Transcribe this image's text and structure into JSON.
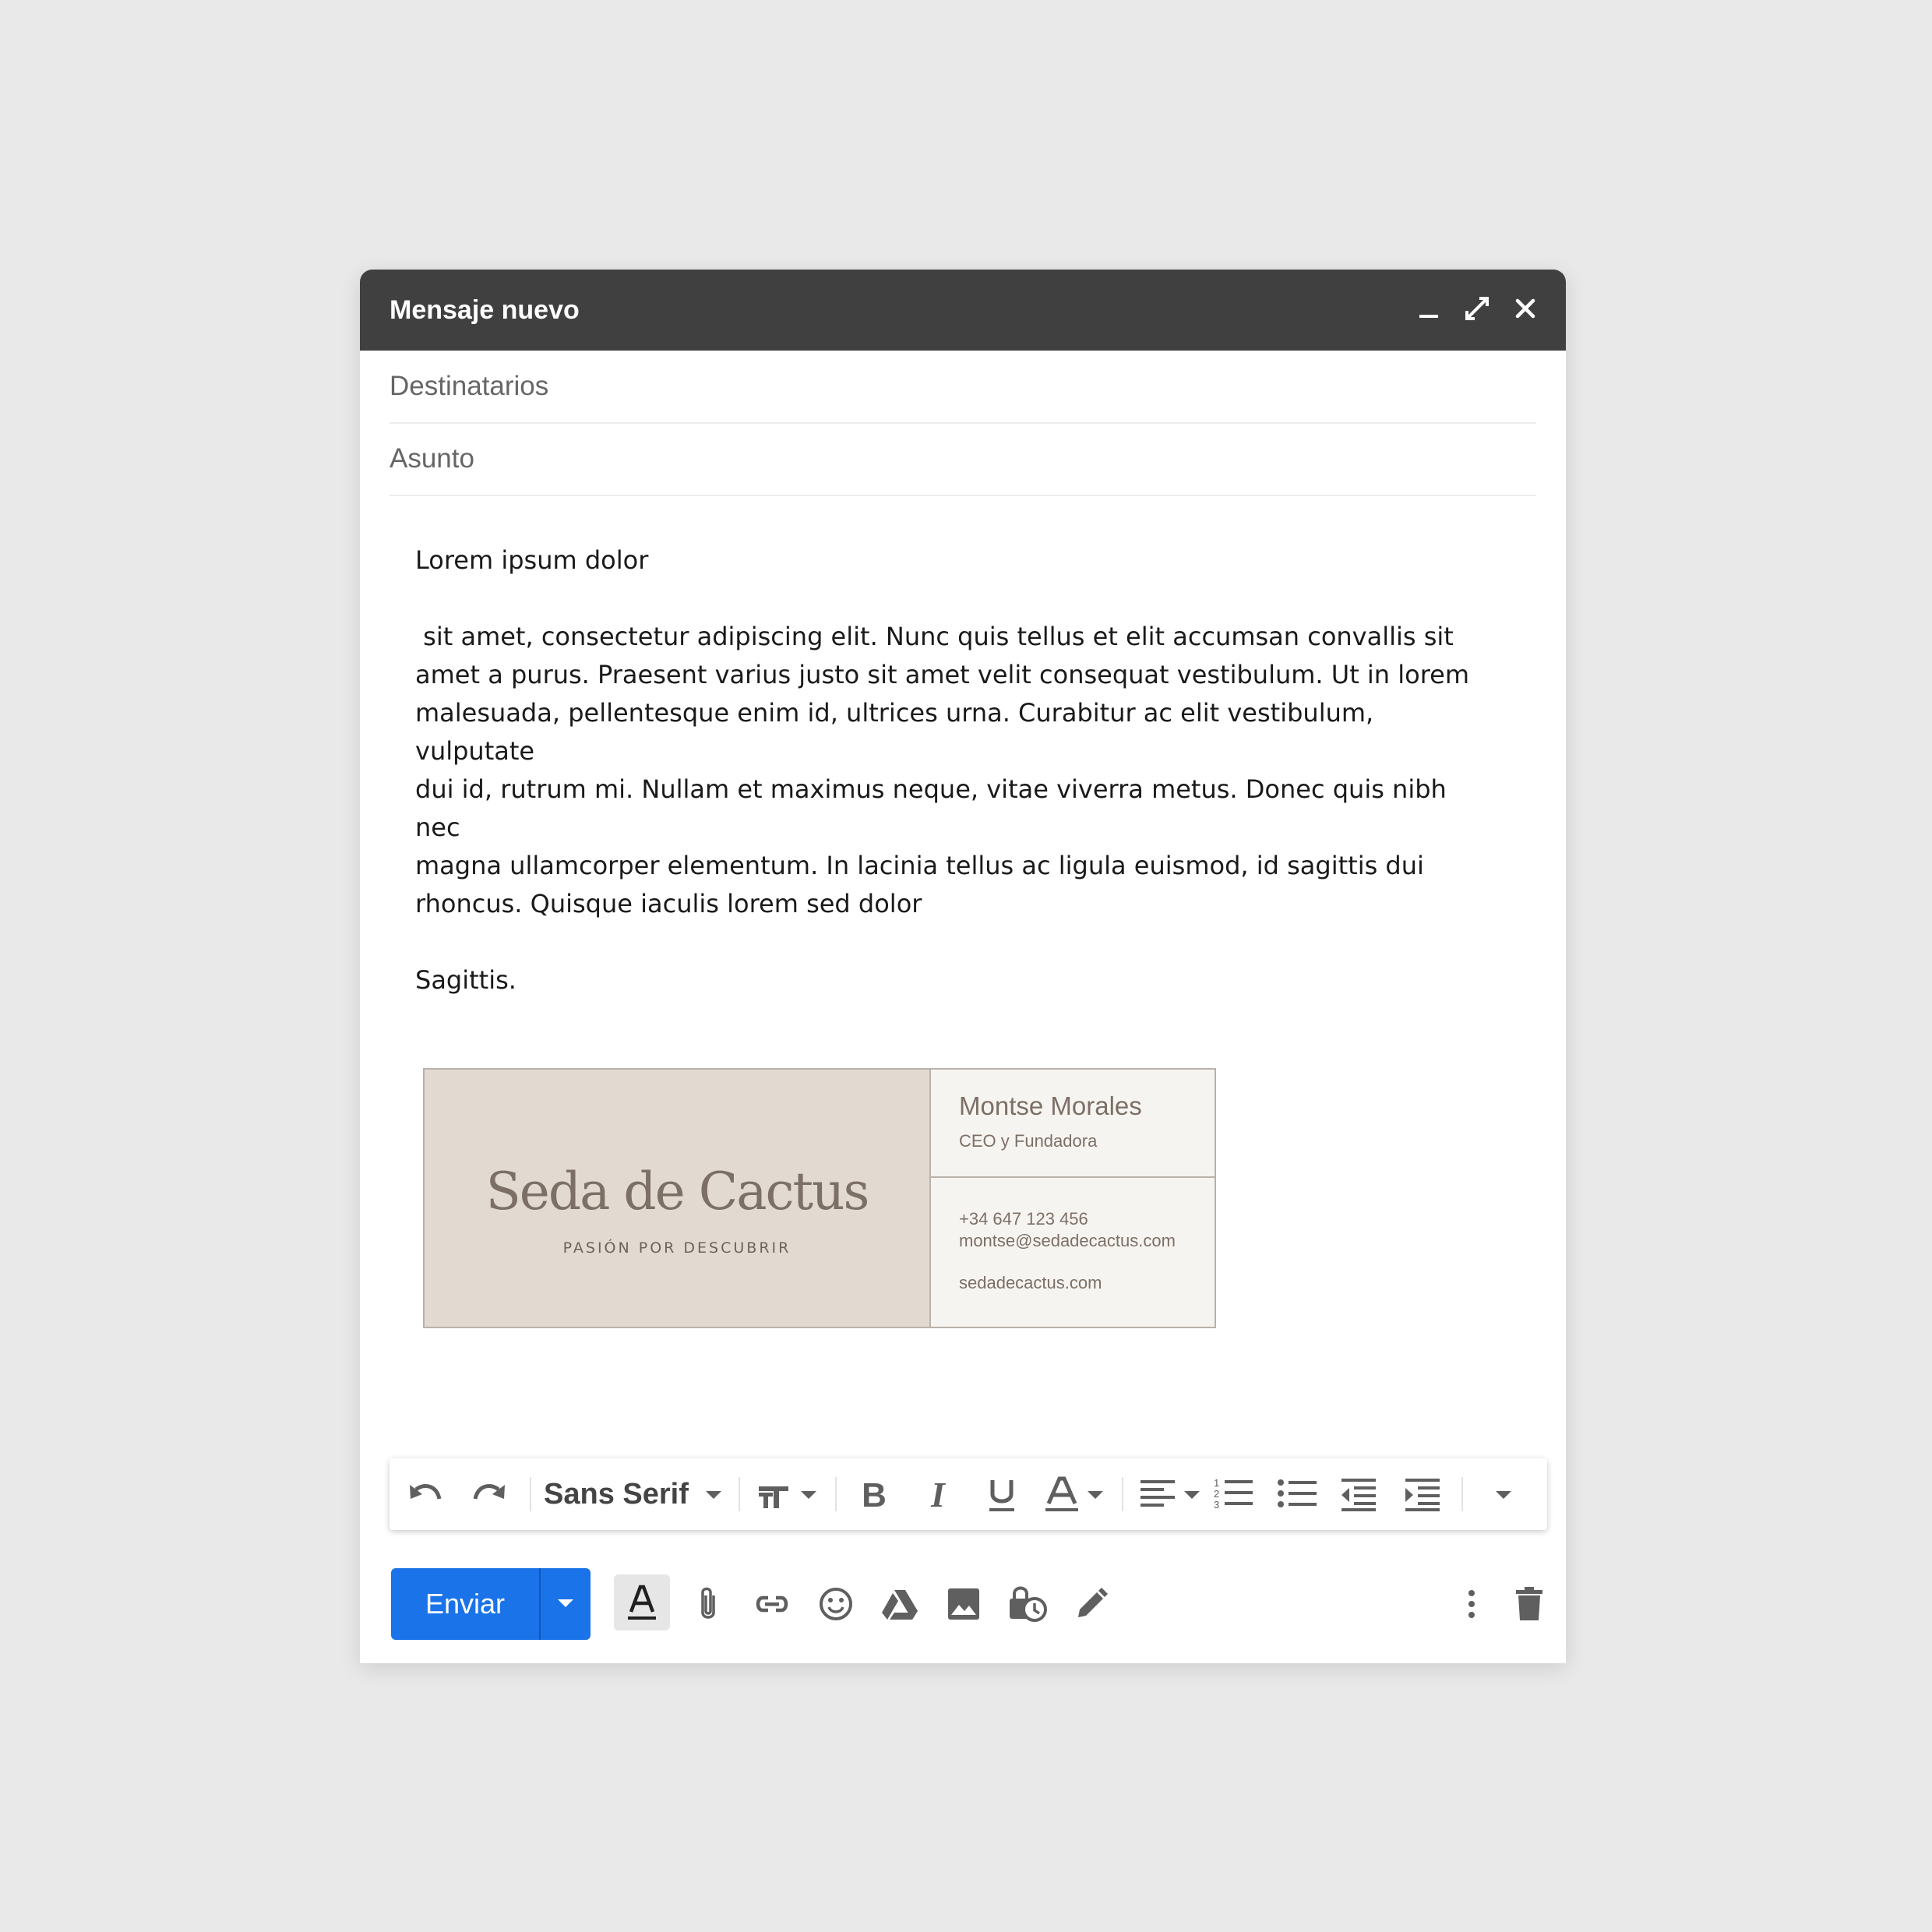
{
  "window": {
    "title": "Mensaje nuevo"
  },
  "fields": {
    "recipients_placeholder": "Destinatarios",
    "subject_placeholder": "Asunto"
  },
  "body": {
    "greeting": "Lorem ipsum dolor",
    "paragraph_lines": [
      " sit amet, consectetur adipiscing elit. Nunc quis tellus et elit accumsan convallis sit",
      "amet a purus. Praesent varius justo sit amet velit consequat vestibulum. Ut in lorem",
      "malesuada, pellentesque enim id, ultrices urna. Curabitur ac elit vestibulum, vulputate",
      "dui id, rutrum mi. Nullam et maximus neque, vitae viverra metus. Donec quis nibh nec",
      "magna ullamcorper elementum. In lacinia tellus ac ligula euismod, id sagittis dui",
      "rhoncus. Quisque iaculis lorem sed dolor"
    ],
    "closing": "Sagittis."
  },
  "signature": {
    "brand": "Seda de Cactus",
    "tagline": "PASIÓN POR DESCUBRIR",
    "name": "Montse Morales",
    "role": "CEO y Fundadora",
    "phone": "+34 647 123 456",
    "email": "montse@sedadecactus.com",
    "website": "sedadecactus.com",
    "colors": {
      "panel": "#e2dad0",
      "text": "#7c6f66",
      "card": "#f6f4f1"
    }
  },
  "format_toolbar": {
    "font": "Sans Serif",
    "icons": [
      "undo-icon",
      "redo-icon",
      "font-family-dropdown",
      "text-size-icon",
      "bold-icon",
      "italic-icon",
      "underline-icon",
      "text-color-icon",
      "align-icon",
      "numbered-list-icon",
      "bulleted-list-icon",
      "indent-less-icon",
      "indent-more-icon",
      "more-formatting-icon"
    ]
  },
  "bottom_toolbar": {
    "send_label": "Enviar",
    "icons": [
      "formatting-options-icon",
      "attach-icon",
      "link-icon",
      "emoji-icon",
      "drive-icon",
      "photo-icon",
      "confidential-mode-icon",
      "signature-icon",
      "more-options-icon",
      "discard-icon"
    ]
  },
  "colors": {
    "titlebar": "#404040",
    "send": "#1a73e8",
    "background": "#e9e9e9",
    "icon": "#5f5f5f"
  }
}
